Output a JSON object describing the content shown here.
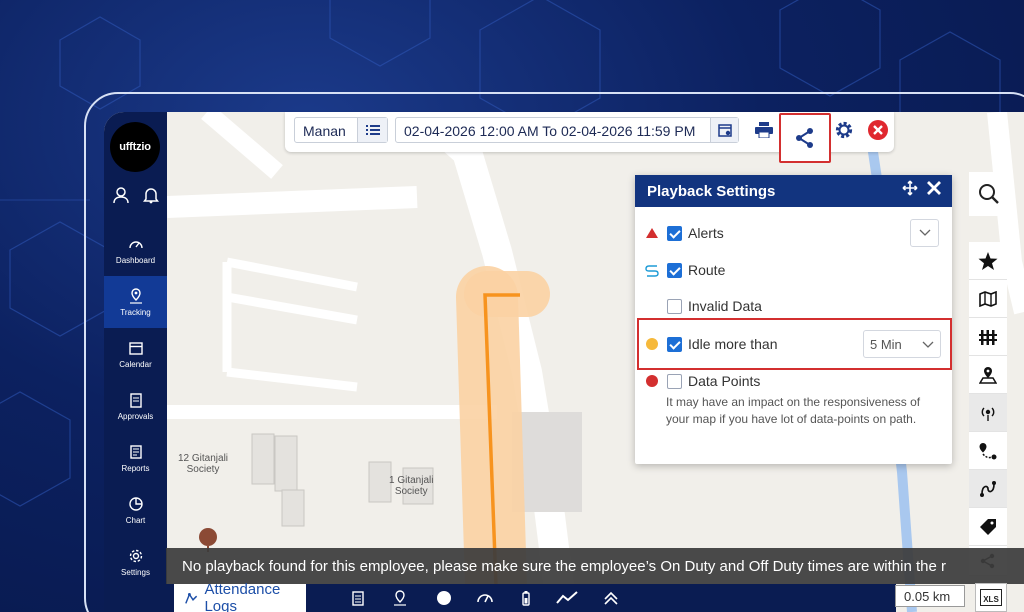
{
  "brand": {
    "logo_text": "ufftzio"
  },
  "sidebar": {
    "items": [
      {
        "label": "Dashboard",
        "icon": "gauge-icon"
      },
      {
        "label": "Tracking",
        "icon": "map-pin-icon",
        "active": true
      },
      {
        "label": "Calendar",
        "icon": "calendar-icon"
      },
      {
        "label": "Approvals",
        "icon": "clipboard-icon"
      },
      {
        "label": "Reports",
        "icon": "report-icon"
      },
      {
        "label": "Chart",
        "icon": "pie-chart-icon"
      },
      {
        "label": "Settings",
        "icon": "gear-icon"
      }
    ]
  },
  "toolbar": {
    "employee": "Manan",
    "date_range": "02-04-2026 12:00 AM To 02-04-2026 11:59 PM"
  },
  "map": {
    "labels": [
      "12 Gitanjali",
      "Society",
      "1 Gitanjali",
      "Society"
    ],
    "scale": "0.05 km"
  },
  "panel": {
    "title": "Playback Settings",
    "options": [
      {
        "label": "Alerts",
        "checked": true,
        "marker": "red-triangle"
      },
      {
        "label": "Route",
        "checked": true,
        "marker": "route-icon"
      },
      {
        "label": "Invalid Data",
        "checked": false,
        "marker": "none"
      },
      {
        "label": "Idle more than",
        "checked": true,
        "marker": "yellow-dot"
      },
      {
        "label": "Data Points",
        "checked": false,
        "marker": "red-dot"
      }
    ],
    "idle_value": "5 Min",
    "note": "It may have an impact on the responsiveness of your map if you have lot of data-points on path."
  },
  "toast": {
    "message": "No playback found for this employee, please make sure the employee’s On Duty and Off Duty times are within the r"
  },
  "bottom": {
    "attendance_label": "Attendance Logs"
  },
  "xls_label": "XLS",
  "colors": {
    "sidebar": "#0a1c52",
    "accent": "#12347f",
    "route": "#f7931e",
    "highlight": "#d32f2f"
  }
}
